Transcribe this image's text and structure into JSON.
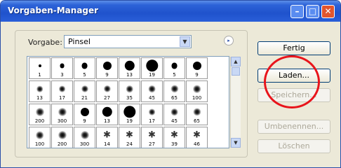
{
  "window": {
    "title": "Vorgaben-Manager"
  },
  "titlebar_buttons": {
    "minimize": "–",
    "maximize": "□",
    "close": "✕"
  },
  "preset": {
    "label": "Vorgabe:",
    "selected": "Pinsel",
    "menu_icon": "▸",
    "dropdown_icon": "▼"
  },
  "scrollbar": {
    "up": "▲",
    "down": "▼"
  },
  "brush_rows": [
    [
      {
        "size": "1",
        "style": "hard"
      },
      {
        "size": "3",
        "style": "hard"
      },
      {
        "size": "5",
        "style": "hard"
      },
      {
        "size": "9",
        "style": "hard"
      },
      {
        "size": "13",
        "style": "hard"
      },
      {
        "size": "19",
        "style": "hard"
      },
      {
        "size": "5",
        "style": "hard"
      },
      {
        "size": "9",
        "style": "hard"
      }
    ],
    [
      {
        "size": "13",
        "style": "soft"
      },
      {
        "size": "17",
        "style": "soft"
      },
      {
        "size": "21",
        "style": "soft"
      },
      {
        "size": "27",
        "style": "soft"
      },
      {
        "size": "35",
        "style": "soft"
      },
      {
        "size": "45",
        "style": "soft"
      },
      {
        "size": "65",
        "style": "soft"
      },
      {
        "size": "100",
        "style": "soft"
      }
    ],
    [
      {
        "size": "200",
        "style": "soft"
      },
      {
        "size": "300",
        "style": "soft"
      },
      {
        "size": "9",
        "style": "hard"
      },
      {
        "size": "13",
        "style": "hard"
      },
      {
        "size": "19",
        "style": "hard"
      },
      {
        "size": "17",
        "style": "soft"
      },
      {
        "size": "45",
        "style": "soft"
      },
      {
        "size": "65",
        "style": "soft"
      }
    ],
    [
      {
        "size": "100",
        "style": "soft"
      },
      {
        "size": "200",
        "style": "soft"
      },
      {
        "size": "300",
        "style": "soft"
      },
      {
        "size": "14",
        "style": "special"
      },
      {
        "size": "24",
        "style": "special"
      },
      {
        "size": "27",
        "style": "special"
      },
      {
        "size": "39",
        "style": "special"
      },
      {
        "size": "46",
        "style": "special"
      }
    ]
  ],
  "buttons": {
    "fertig": "Fertig",
    "laden": "Laden...",
    "speichern": "Speichern...",
    "umbenennen": "Umbenennen...",
    "loeschen": "Löschen"
  },
  "colors": {
    "highlight_circle": "#e8141b",
    "title_bar": "#2d63d8"
  }
}
